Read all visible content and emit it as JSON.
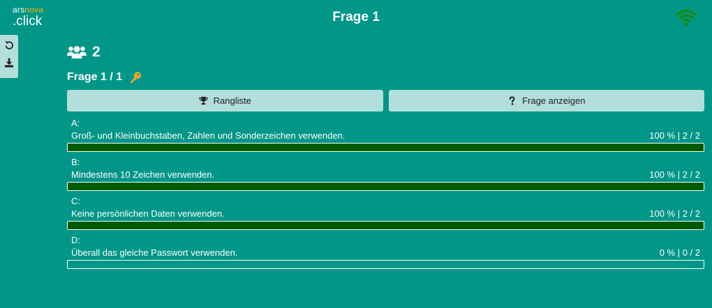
{
  "logo": {
    "part1": "ars",
    "part2": "nova",
    "part3": ".click"
  },
  "header": {
    "title": "Frage 1"
  },
  "colors": {
    "background": "#009688",
    "panel": "#b2dfdb",
    "bar_fill": "#005a00",
    "logo_accent": "#ffb300",
    "wifi": "#1b8a00"
  },
  "toolbar": {
    "icons": [
      "undo-icon",
      "download-icon"
    ]
  },
  "attendees": {
    "count": "2",
    "icon": "users-icon"
  },
  "question": {
    "label": "Frage 1 / 1",
    "icon": "key-icon"
  },
  "buttons": {
    "leaderboard": {
      "label": "Rangliste",
      "icon": "trophy-icon"
    },
    "show_question": {
      "label": "Frage anzeigen",
      "icon": "question-icon"
    }
  },
  "answers": [
    {
      "letter": "A:",
      "text": "Groß- und Kleinbuchstaben, Zahlen und Sonderzeichen verwenden.",
      "stats": "100 % | 2 / 2",
      "percent": 100
    },
    {
      "letter": "B:",
      "text": "Mindestens 10 Zeichen verwenden.",
      "stats": "100 % | 2 / 2",
      "percent": 100
    },
    {
      "letter": "C:",
      "text": "Keine persönlichen Daten verwenden.",
      "stats": "100 % | 2 / 2",
      "percent": 100
    },
    {
      "letter": "D:",
      "text": "Überall das gleiche Passwort verwenden.",
      "stats": "0 % | 0 / 2",
      "percent": 0
    }
  ]
}
